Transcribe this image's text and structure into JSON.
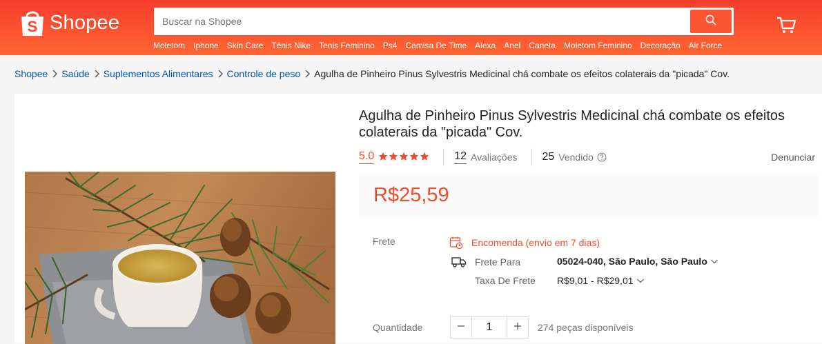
{
  "header": {
    "brand": "Shopee",
    "search_placeholder": "Buscar na Shopee",
    "hotwords": [
      "Moletom",
      "Iphone",
      "Skin Care",
      "Tênis Nike",
      "Tenis Feminino",
      "Ps4",
      "Camisa De Time",
      "Alexa",
      "Anel",
      "Caneta",
      "Moletom Feminino",
      "Decoração",
      "Air Force"
    ],
    "icons": {
      "search": "search-icon",
      "cart": "cart-icon"
    }
  },
  "breadcrumb": {
    "items": [
      "Shopee",
      "Saúde",
      "Suplementos Alimentares",
      "Controle de peso"
    ],
    "current": "Agulha de Pinheiro Pinus Sylvestris Medicinal chá combate os efeitos colaterais da \"picada\" Cov."
  },
  "product": {
    "title": "Agulha de Pinheiro Pinus Sylvestris Medicinal chá combate os efeitos colaterais da \"picada\" Cov.",
    "rating": "5.0",
    "stars": 5,
    "reviews_count": "12",
    "reviews_label": "Avaliações",
    "sold_count": "25",
    "sold_label": "Vendido",
    "report_label": "Denunciar",
    "price": "R$25,59"
  },
  "shipping": {
    "label": "Frete",
    "order_text": "Encomenda (envio em 7 dias)",
    "to_label": "Frete Para",
    "address": "05024-040, São Paulo, São Paulo",
    "fee_label": "Taxa De Frete",
    "fee_value": "R$9,01 - R$29,01"
  },
  "quantity": {
    "label": "Quantidade",
    "minus": "−",
    "value": "1",
    "plus": "+",
    "stock": "274 peças disponíveis"
  },
  "colors": {
    "brand": "#ee4d2d",
    "link": "#0055aa"
  }
}
